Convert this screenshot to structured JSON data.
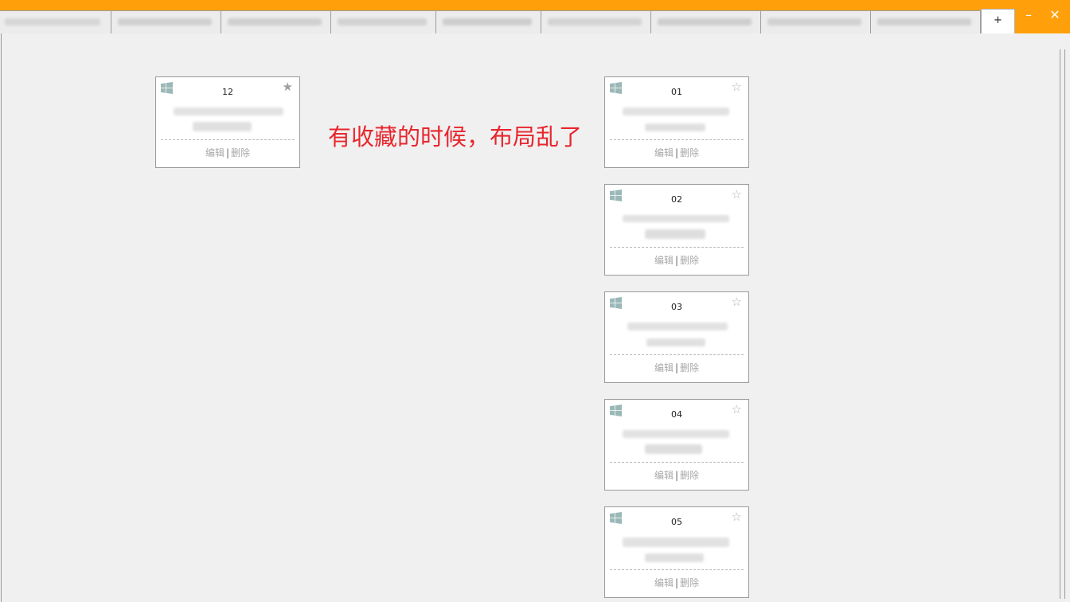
{
  "window": {
    "new_tab_label": "+",
    "minimize_label": "–",
    "close_label": "✕",
    "accent_color": "#ff9f0a"
  },
  "annotation": "有收藏的时候，布局乱了",
  "cards": [
    {
      "number": "12",
      "favorite": true,
      "edit": "编辑",
      "separator": "|",
      "delete": "删除"
    },
    {
      "number": "01",
      "favorite": false,
      "edit": "编辑",
      "separator": "|",
      "delete": "删除"
    },
    {
      "number": "02",
      "favorite": false,
      "edit": "编辑",
      "separator": "|",
      "delete": "删除"
    },
    {
      "number": "03",
      "favorite": false,
      "edit": "编辑",
      "separator": "|",
      "delete": "删除"
    },
    {
      "number": "04",
      "favorite": false,
      "edit": "编辑",
      "separator": "|",
      "delete": "删除"
    },
    {
      "number": "05",
      "favorite": false,
      "edit": "编辑",
      "separator": "|",
      "delete": "删除"
    }
  ],
  "icons": {
    "os": "windows-logo-icon",
    "favorite": "star-icon"
  }
}
